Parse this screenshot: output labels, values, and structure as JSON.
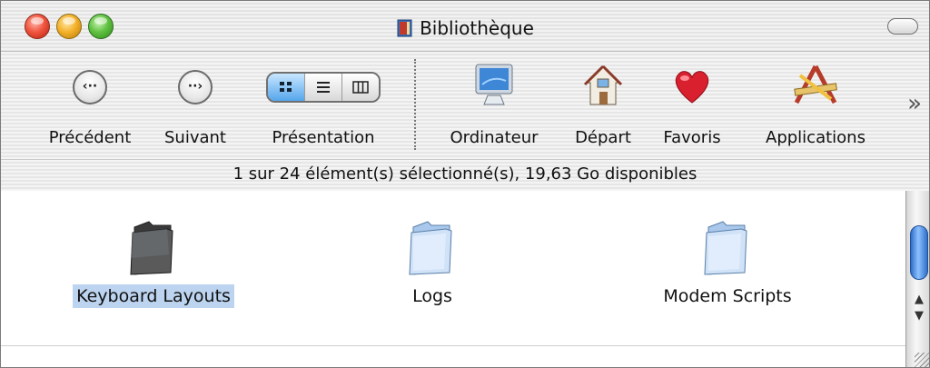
{
  "window": {
    "title": "Bibliothèque",
    "title_icon": "library-book-icon"
  },
  "toolbar": {
    "back_label": "Précédent",
    "forward_label": "Suivant",
    "view_label": "Présentation",
    "computer_label": "Ordinateur",
    "home_label": "Départ",
    "favorites_label": "Favoris",
    "applications_label": "Applications",
    "overflow_glyph": "»",
    "view_modes": [
      "icon-view-icon",
      "list-view-icon",
      "column-view-icon"
    ],
    "active_view": "icon-view-icon"
  },
  "status": {
    "text": "1 sur 24 élément(s) sélectionné(s), 19,63 Go disponibles"
  },
  "files": [
    {
      "name": "Keyboard Layouts",
      "icon": "dark-folder-icon",
      "selected": true
    },
    {
      "name": "Logs",
      "icon": "folder-icon",
      "selected": false
    },
    {
      "name": "Modem Scripts",
      "icon": "folder-icon",
      "selected": false
    }
  ],
  "colors": {
    "selection": "#bcd4ef",
    "scroll_thumb": "#3d86e0"
  }
}
